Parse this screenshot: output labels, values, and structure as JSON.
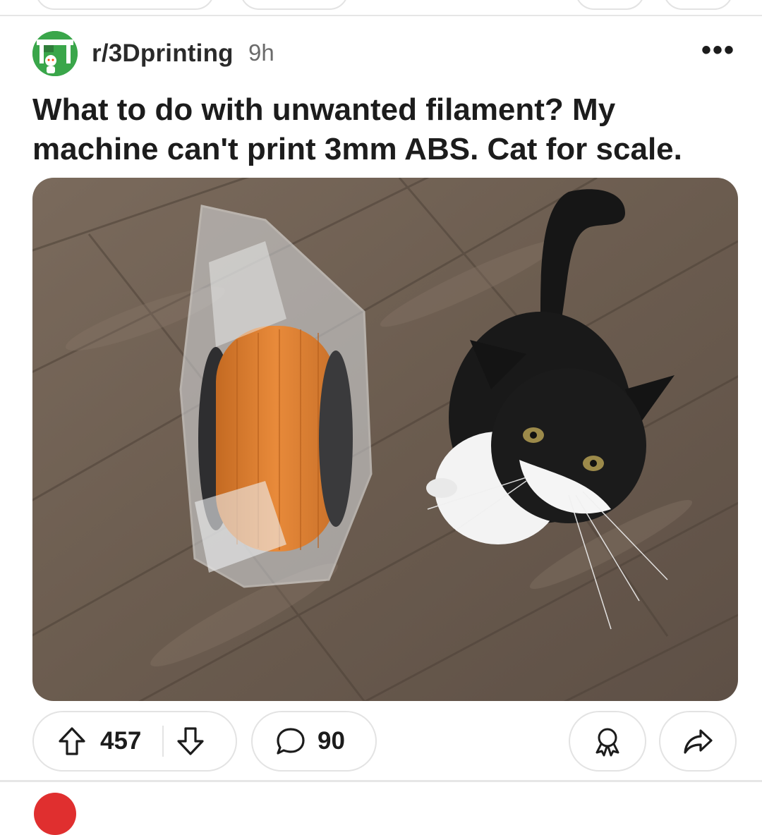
{
  "post": {
    "subreddit": "r/3Dprinting",
    "age": "9h",
    "more_icon": "more-horizontal-icon",
    "title": "What to do with unwanted filament? My machine can't print 3mm ABS. Cat for scale.",
    "image_icon": "photo-cat-and-filament-spool"
  },
  "actions": {
    "upvote_icon": "arrow-up-outline-icon",
    "score": "457",
    "downvote_icon": "arrow-down-outline-icon",
    "comment_icon": "speech-bubble-icon",
    "comments": "90",
    "award_icon": "award-ribbon-icon",
    "share_icon": "share-arrow-icon"
  },
  "colors": {
    "subreddit_avatar": "#3aa64a",
    "pill_border": "#e3e3e3",
    "text": "#1c1c1c",
    "muted": "#6b6b6b"
  }
}
